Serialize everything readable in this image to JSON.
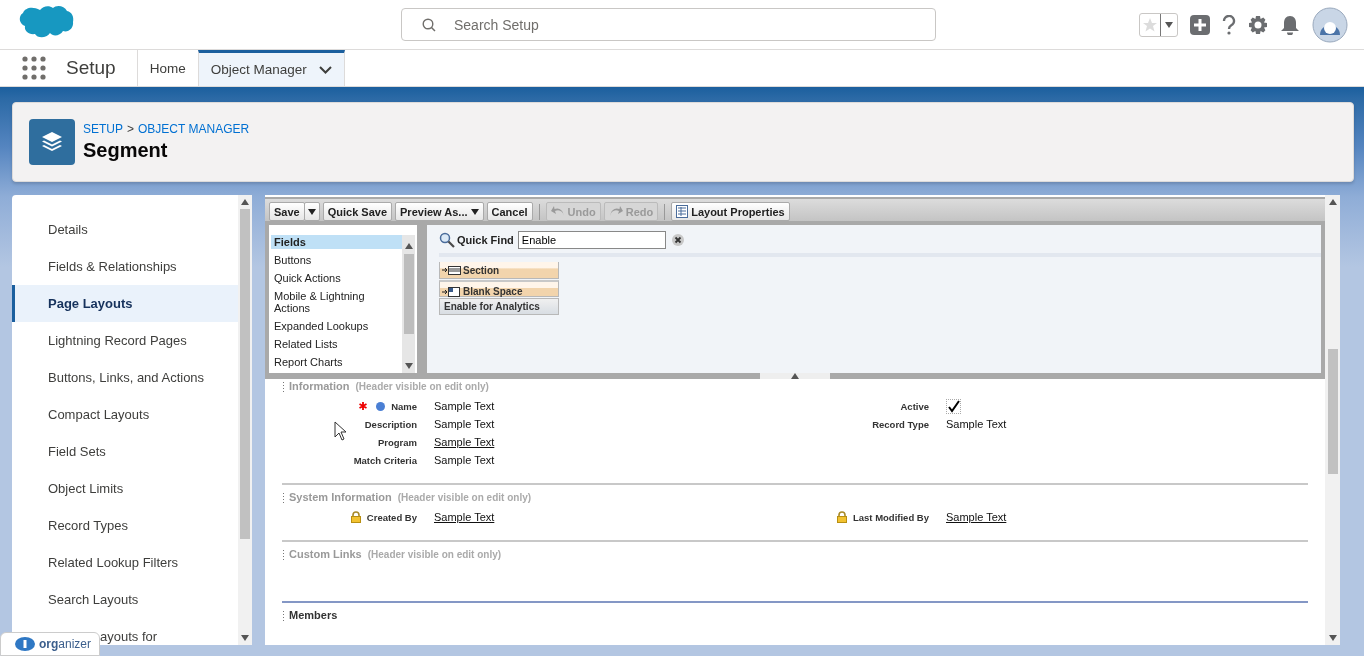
{
  "header": {
    "search": {
      "placeholder": "Search Setup"
    }
  },
  "nav": {
    "app_name": "Setup",
    "tabs": [
      {
        "label": "Home",
        "selected": false
      },
      {
        "label": "Object Manager",
        "selected": true
      }
    ]
  },
  "page_header": {
    "breadcrumbs": [
      "SETUP",
      "OBJECT MANAGER"
    ],
    "separator": ">",
    "title": "Segment"
  },
  "sidebar": {
    "items": [
      {
        "label": "Details",
        "selected": false,
        "covered": false
      },
      {
        "label": "Fields & Relationships",
        "selected": false,
        "covered": false
      },
      {
        "label": "Page Layouts",
        "selected": true,
        "covered": false
      },
      {
        "label": "Lightning Record Pages",
        "selected": false,
        "covered": false
      },
      {
        "label": "Buttons, Links, and Actions",
        "selected": false,
        "covered": false
      },
      {
        "label": "Compact Layouts",
        "selected": false,
        "covered": false
      },
      {
        "label": "Field Sets",
        "selected": false,
        "covered": false
      },
      {
        "label": "Object Limits",
        "selected": false,
        "covered": false
      },
      {
        "label": "Record Types",
        "selected": false,
        "covered": false
      },
      {
        "label": "Related Lookup Filters",
        "selected": false,
        "covered": false
      },
      {
        "label": "Search Layouts",
        "selected": false,
        "covered": false
      },
      {
        "label": "ayouts for",
        "selected": false,
        "covered": true
      }
    ]
  },
  "palette": {
    "toolbar": [
      [
        {
          "label": "Save",
          "kind": "split",
          "disabled": false
        },
        {
          "label": "Quick Save",
          "kind": "plain",
          "disabled": false
        },
        {
          "label": "Preview As...",
          "kind": "menu",
          "disabled": false
        },
        {
          "label": "Cancel",
          "kind": "plain",
          "disabled": false
        }
      ],
      [
        {
          "label": "Undo",
          "kind": "undo",
          "disabled": true
        },
        {
          "label": "Redo",
          "kind": "redo",
          "disabled": true
        }
      ],
      [
        {
          "label": "Layout Properties",
          "kind": "properties",
          "disabled": false
        }
      ]
    ],
    "categories": [
      {
        "label": "Fields",
        "selected": true
      },
      {
        "label": "Buttons",
        "selected": false
      },
      {
        "label": "Quick Actions",
        "selected": false
      },
      {
        "label": "Mobile & Lightning Actions",
        "selected": false
      },
      {
        "label": "Expanded Lookups",
        "selected": false
      },
      {
        "label": "Related Lists",
        "selected": false
      },
      {
        "label": "Report Charts",
        "selected": false
      }
    ],
    "quick_find": {
      "label": "Quick Find",
      "value": "Enable"
    },
    "items": [
      {
        "label": "Section",
        "kind": "section"
      },
      {
        "label": "Blank Space",
        "kind": "blank"
      },
      {
        "label": "Enable for Analytics",
        "kind": "field"
      }
    ]
  },
  "layout": {
    "sections": [
      {
        "title": "Information",
        "note": "(Header visible on edit only)",
        "kind": "section",
        "columns": [
          [
            {
              "label": "Name",
              "value": "Sample Text",
              "kind": "text",
              "required": true,
              "primary": true,
              "locked": false
            },
            {
              "label": "Description",
              "value": "Sample Text",
              "kind": "text",
              "required": false,
              "primary": false,
              "locked": false
            },
            {
              "label": "Program",
              "value": "Sample Text",
              "kind": "link",
              "required": false,
              "primary": false,
              "locked": false
            },
            {
              "label": "Match Criteria",
              "value": "Sample Text",
              "kind": "text",
              "required": false,
              "primary": false,
              "locked": false
            }
          ],
          [
            {
              "label": "Active",
              "checked": true,
              "kind": "checkbox",
              "required": false,
              "primary": false,
              "locked": false
            },
            {
              "label": "Record Type",
              "value": "Sample Text",
              "kind": "text",
              "required": false,
              "primary": false,
              "locked": false
            }
          ]
        ]
      },
      {
        "title": "System Information",
        "note": "(Header visible on edit only)",
        "kind": "section",
        "columns": [
          [
            {
              "label": "Created By",
              "value": "Sample Text",
              "kind": "link",
              "required": false,
              "primary": false,
              "locked": true
            }
          ],
          [
            {
              "label": "Last Modified By",
              "value": "Sample Text",
              "kind": "link",
              "required": false,
              "primary": false,
              "locked": true
            }
          ]
        ]
      },
      {
        "title": "Custom Links",
        "note": "(Header visible on edit only)",
        "kind": "section"
      },
      {
        "title": "Members",
        "kind": "related_list"
      }
    ]
  },
  "organizer": {
    "label": "**org**anizer"
  }
}
